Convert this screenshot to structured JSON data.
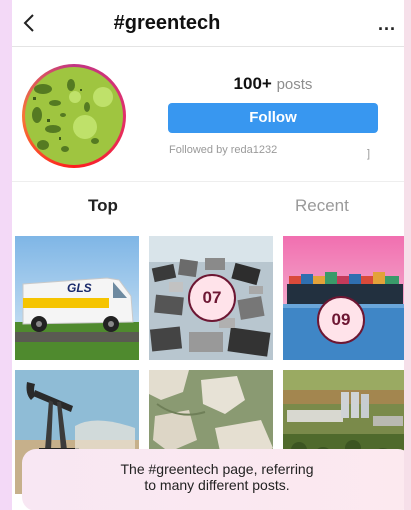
{
  "header": {
    "title": "#greentech",
    "back_icon": "chevron-left-icon",
    "more_label": "..."
  },
  "profile": {
    "posts_count": "100+",
    "posts_label": "posts",
    "follow_label": "Follow",
    "followed_by": "Followed by reda1232",
    "followed_extra": "]"
  },
  "tabs": [
    {
      "label": "Top",
      "active": true
    },
    {
      "label": "Recent",
      "active": false
    }
  ],
  "grid": {
    "posts": [
      {
        "image": "gls-delivery-van"
      },
      {
        "image": "electronic-waste-pile",
        "badge": "07"
      },
      {
        "image": "container-ship",
        "badge": "09"
      },
      {
        "image": "oil-pumpjack"
      },
      {
        "image": "aerial-landscape"
      },
      {
        "image": "industrial-plant"
      }
    ],
    "van_logo": "GLS"
  },
  "caption": {
    "line1": "The #greentech page, referring",
    "line2": "to many different posts."
  },
  "colors": {
    "follow_button": "#3897f0",
    "badge_fill": "#ffe3ea",
    "badge_border": "#6d1733",
    "muted_text": "#8e8e8e"
  }
}
